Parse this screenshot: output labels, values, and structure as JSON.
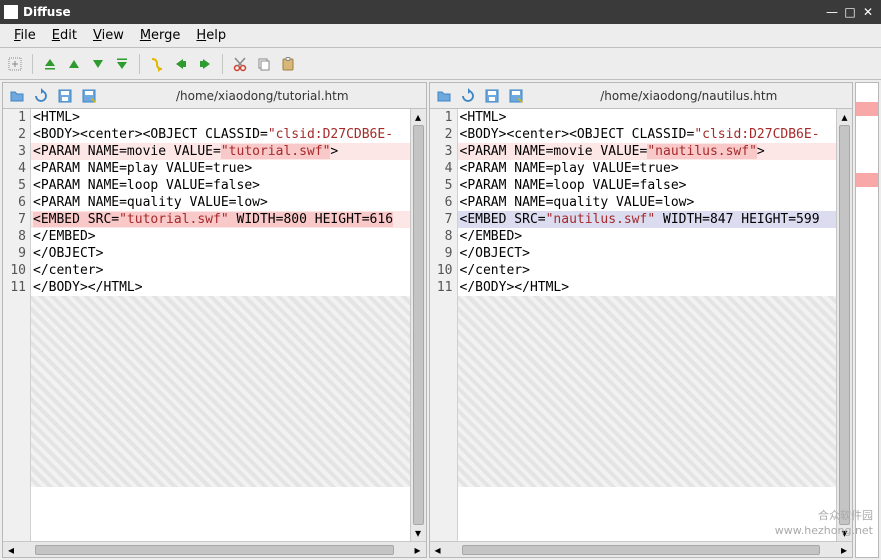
{
  "window": {
    "title": "Diffuse"
  },
  "menu": {
    "file": "File",
    "edit": "Edit",
    "view": "View",
    "merge": "Merge",
    "help": "Help",
    "file_u": "F",
    "edit_u": "E",
    "view_u": "V",
    "merge_u": "M",
    "help_u": "H"
  },
  "panes": [
    {
      "path": "/home/xiaodong/tutorial.htm",
      "lines": [
        {
          "n": 1,
          "text": "<HTML>",
          "diff": false
        },
        {
          "n": 2,
          "text": "<BODY><center><OBJECT CLASSID=\"clsid:D27CDB6E-",
          "diff": false,
          "value_range": [
            30,
            48
          ]
        },
        {
          "n": 3,
          "text": "<PARAM NAME=movie VALUE=\"tutorial.swf\">",
          "diff": true,
          "value_range": [
            24,
            38
          ],
          "hl_range": [
            24,
            38
          ]
        },
        {
          "n": 4,
          "text": "<PARAM NAME=play VALUE=true>",
          "diff": false
        },
        {
          "n": 5,
          "text": "<PARAM NAME=loop VALUE=false>",
          "diff": false
        },
        {
          "n": 6,
          "text": "<PARAM NAME=quality VALUE=low>",
          "diff": false
        },
        {
          "n": 7,
          "text": "<EMBED SRC=\"tutorial.swf\" WIDTH=800 HEIGHT=616",
          "diff": true,
          "value_range": [
            11,
            25
          ],
          "hl_range": [
            0,
            46
          ]
        },
        {
          "n": 8,
          "text": "</EMBED>",
          "diff": false
        },
        {
          "n": 9,
          "text": "</OBJECT>",
          "diff": false
        },
        {
          "n": 10,
          "text": "</center>",
          "diff": false
        },
        {
          "n": 11,
          "text": "</BODY></HTML>",
          "diff": false
        }
      ]
    },
    {
      "path": "/home/xiaodong/nautilus.htm",
      "lines": [
        {
          "n": 1,
          "text": "<HTML>",
          "diff": false
        },
        {
          "n": 2,
          "text": "<BODY><center><OBJECT CLASSID=\"clsid:D27CDB6E-",
          "diff": false,
          "value_range": [
            30,
            48
          ]
        },
        {
          "n": 3,
          "text": "<PARAM NAME=movie VALUE=\"nautilus.swf\">",
          "diff": true,
          "value_range": [
            24,
            38
          ],
          "hl_range": [
            24,
            38
          ]
        },
        {
          "n": 4,
          "text": "<PARAM NAME=play VALUE=true>",
          "diff": false
        },
        {
          "n": 5,
          "text": "<PARAM NAME=loop VALUE=false>",
          "diff": false
        },
        {
          "n": 6,
          "text": "<PARAM NAME=quality VALUE=low>",
          "diff": false
        },
        {
          "n": 7,
          "text": "<EMBED SRC=\"nautilus.swf\" WIDTH=847 HEIGHT=599",
          "diff": true,
          "sel": true,
          "value_range": [
            11,
            25
          ]
        },
        {
          "n": 8,
          "text": "</EMBED>",
          "diff": false
        },
        {
          "n": 9,
          "text": "</OBJECT>",
          "diff": false
        },
        {
          "n": 10,
          "text": "</center>",
          "diff": false
        },
        {
          "n": 11,
          "text": "</BODY></HTML>",
          "diff": false
        }
      ]
    }
  ],
  "overview_marks": [
    {
      "top_pct": 4,
      "h_pct": 3
    },
    {
      "top_pct": 19,
      "h_pct": 3
    }
  ],
  "watermark": {
    "line1": "合众软件园",
    "line2": "www.hezhong.net"
  },
  "colors": {
    "toolbar_green": "#2e9b2e",
    "toolbar_yellow": "#e0b800",
    "toolbar_red": "#d04030"
  }
}
